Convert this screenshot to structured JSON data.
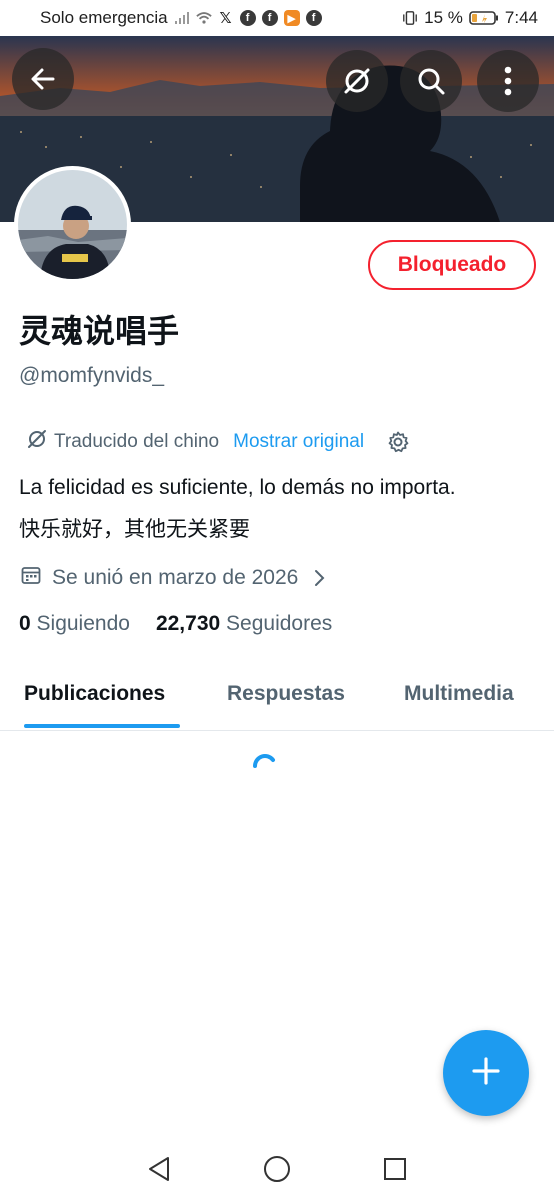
{
  "status_bar": {
    "carrier": "Solo emergencia",
    "battery": "15 %",
    "time": "7:44"
  },
  "profile": {
    "display_name": "灵魂说唱手",
    "handle": "@momfynvids_",
    "block_button": "Bloqueado"
  },
  "translation": {
    "notice": "Traducido del chino",
    "show_original": "Mostrar original"
  },
  "bio": {
    "translated": "La felicidad es suficiente, lo demás no importa.",
    "original": "快乐就好，其他无关紧要"
  },
  "joined": "Se unió en marzo de 2026",
  "stats": {
    "following_count": "0",
    "following_label": "Siguiendo",
    "followers_count": "22,730",
    "followers_label": "Seguidores"
  },
  "tabs": [
    {
      "label": "Publicaciones",
      "active": true
    },
    {
      "label": "Respuestas",
      "active": false
    },
    {
      "label": "Multimedia",
      "active": false
    }
  ],
  "colors": {
    "accent": "#1d9bf0",
    "danger": "#f4212e",
    "muted": "#536471"
  },
  "icons": [
    "back-arrow-icon",
    "translate-icon",
    "search-icon",
    "more-vertical-icon",
    "settings-gear-icon",
    "calendar-icon",
    "chevron-right-icon",
    "plus-icon"
  ]
}
